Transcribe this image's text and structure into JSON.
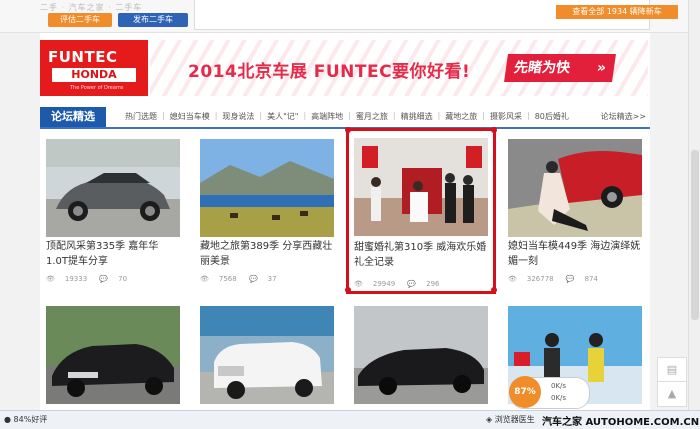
{
  "top": {
    "faded_text": "二手 · 汽车之家 · 二手车",
    "sell_label": "评估二手车",
    "post_label": "发布二手车",
    "view_all_label": "查看全部 1934 辆降新车"
  },
  "banner": {
    "logo_main": "FUNTEC",
    "logo_brand": "HONDA",
    "logo_tag": "The Power of Dreams",
    "headline": "2014北京车展 FUNTEC要你好看!",
    "cta": "先睹为快",
    "cta_arrow": "»"
  },
  "nav": {
    "title": "论坛精选",
    "items": [
      "热门选题",
      "媳妇当车模",
      "现身说法",
      "美人\"记\"",
      "高端阵地",
      "蜜月之旅",
      "精挑细选",
      "藏地之旅",
      "摄影风采",
      "80后婚礼"
    ],
    "more": "论坛精选>>"
  },
  "cards": [
    {
      "caption": "顶配风采第335季 嘉年华1.0T提车分享",
      "views": "19333",
      "replies": "70"
    },
    {
      "caption": "藏地之旅第389季 分享西藏壮丽美景",
      "views": "7568",
      "replies": "37"
    },
    {
      "caption": "甜蜜婚礼第310季 威海欢乐婚礼全记录",
      "views": "29949",
      "replies": "296"
    },
    {
      "caption": "媳妇当车模449季 海边演绎妩媚一刻",
      "views": "326778",
      "replies": "874"
    }
  ],
  "status": {
    "good": "84%好评",
    "doctor": "浏览器医生",
    "site": "汽车之家 AUTOHOME.COM.CN",
    "gauge_pct": "87%",
    "gauge_up": "0K/s",
    "gauge_down": "0K/s"
  },
  "colors": {
    "accent_blue": "#1e5aab",
    "accent_orange": "#f08c2a",
    "selection_red": "#d4101c"
  }
}
